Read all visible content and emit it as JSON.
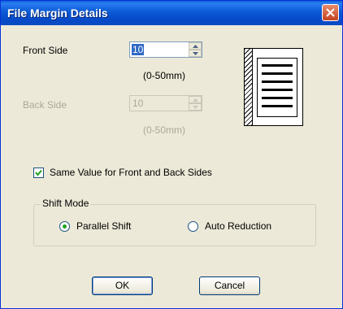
{
  "window": {
    "title": "File Margin Details"
  },
  "front": {
    "label": "Front Side",
    "value": "10",
    "range": "(0-50mm)"
  },
  "back": {
    "label": "Back Side",
    "value": "10",
    "range": "(0-50mm)"
  },
  "same_value": {
    "label": "Same Value for Front and Back Sides",
    "checked": true
  },
  "shift_mode": {
    "title": "Shift Mode",
    "options": [
      {
        "label": "Parallel Shift",
        "selected": true
      },
      {
        "label": "Auto Reduction",
        "selected": false
      }
    ]
  },
  "buttons": {
    "ok": "OK",
    "cancel": "Cancel"
  },
  "icons": {
    "close": "close-icon",
    "preview": "page-preview-icon",
    "check": "checkmark-icon"
  },
  "colors": {
    "titlebar": "#0b5ad6",
    "close": "#c4441f",
    "selection": "#316ac5",
    "radio_dot": "#21a121"
  }
}
